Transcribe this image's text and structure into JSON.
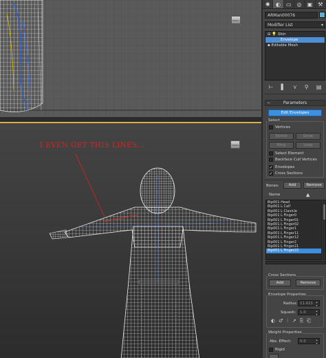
{
  "annotation": "I EVEN GET THIS LINES...",
  "viewport_top": {
    "navcube_label": "FRONT"
  },
  "viewport_main": {
    "navcube_label": "FRONT"
  },
  "panel": {
    "tabs": [
      "create-icon",
      "modify-icon",
      "hierarchy-icon",
      "motion-icon",
      "display-icon",
      "utilities-icon"
    ],
    "object_name": "ARMan00076",
    "object_color": "#5ab0d8",
    "modifier_list_label": "Modifier List",
    "stack": [
      {
        "label": "Skin",
        "selected": false
      },
      {
        "label": "Envelope",
        "selected": true
      },
      {
        "label": "Editable Mesh",
        "selected": false
      }
    ],
    "parameters_title": "Parameters",
    "edit_envelopes": "Edit Envelopes",
    "select_group": "Select",
    "vertices": "Vertices",
    "shrink": "Shrink",
    "grow": "Grow",
    "ring": "Ring",
    "loop": "Loop",
    "select_element": "Select Element",
    "backface_cull": "Backface Cull Vertices",
    "envelopes": "Envelopes",
    "cross_sections": "Cross Sections",
    "bones_label": "Bones:",
    "add": "Add",
    "remove": "Remove",
    "name_col": "Name",
    "bones": [
      "Bip001 Head",
      "Bip001 L Calf",
      "Bip001 L Clavicle",
      "Bip001 L Finger0",
      "Bip001 L Finger01",
      "Bip001 L Finger02",
      "Bip001 L Finger1",
      "Bip001 L Finger11",
      "Bip001 L Finger12",
      "Bip001 L Finger2",
      "Bip001 L Finger21",
      "Bip001 L Finger22"
    ],
    "selected_bone_index": 11,
    "cross_sections_group": "Cross Sections",
    "cs_add": "Add",
    "cs_remove": "Remove",
    "envelope_props_group": "Envelope Properties",
    "radius_label": "Radius:",
    "radius_value": "11.621",
    "squash_label": "Squash:",
    "squash_value": "1.0",
    "weight_props_group": "Weight Properties",
    "abs_effect_label": "Abs. Effect:",
    "abs_effect_value": "0.0",
    "rigid": "Rigid"
  }
}
